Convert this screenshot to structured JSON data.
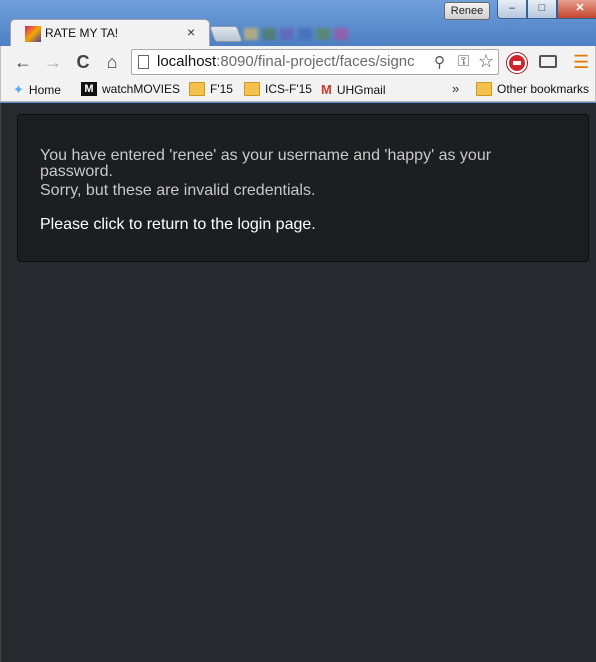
{
  "window": {
    "profile_name": "Renee",
    "minimize": "–",
    "maximize": "□",
    "close": "✕"
  },
  "tab": {
    "title": "RATE MY TA!",
    "close": "×"
  },
  "toolbar": {
    "back": "←",
    "forward": "→",
    "reload": "C",
    "home": "⌂",
    "url_host": "localhost",
    "url_rest": ":8090/final-project/faces/signc",
    "search_icon": "magnifier-icon",
    "key_icon": "key-icon",
    "star_icon": "star-icon"
  },
  "bookmarks": {
    "items": [
      {
        "label": "Home",
        "icon": "twitter-icon"
      },
      {
        "label": "watchMOVIES",
        "icon": "m-icon"
      },
      {
        "label": "F'15",
        "icon": "folder-icon"
      },
      {
        "label": "ICS-F'15",
        "icon": "folder-icon"
      },
      {
        "label": "UHGmail",
        "icon": "gmail-icon"
      }
    ],
    "overflow": "»",
    "other": "Other bookmarks"
  },
  "page": {
    "message_line1": "You have entered 'renee' as your username and 'happy' as your password.",
    "message_line2": "Sorry, but these are invalid credentials.",
    "link_text": "Please click to return to the login page."
  }
}
